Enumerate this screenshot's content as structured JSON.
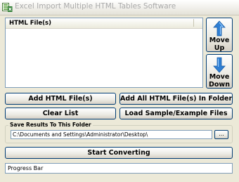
{
  "window": {
    "title": "Excel Import Multiple HTML Tables Software",
    "app_icon": "excel-app-icon"
  },
  "file_list": {
    "column_header": "HTML File(s)",
    "items": []
  },
  "side_buttons": {
    "move_up": {
      "label": "Move\nUp",
      "icon": "arrow-up-icon"
    },
    "move_down": {
      "label": "Move\nDown",
      "icon": "arrow-down-icon"
    }
  },
  "buttons": {
    "add_files": "Add HTML File(s)",
    "add_all_in_folder": "Add All HTML File(s) In Folder",
    "clear_list": "Clear List",
    "load_sample": "Load Sample/Example Files",
    "start_converting": "Start Converting"
  },
  "save_group": {
    "legend": "Save Results To This Folder",
    "path_value": "C:\\Documents and Settings\\Administrator\\Desktop\\",
    "browse_label": "..."
  },
  "progress": {
    "label": "Progress Bar",
    "value": 0
  },
  "colors": {
    "window_bg": "#ece9d8",
    "button_border": "#003c74",
    "input_border": "#7f9db9",
    "arrow_blue": "#2f7fd3"
  }
}
